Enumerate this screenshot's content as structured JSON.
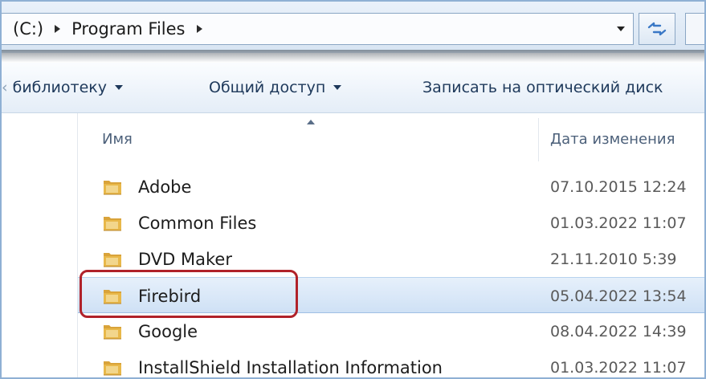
{
  "address_bar": {
    "crumbs": [
      "(C:)",
      "Program Files"
    ]
  },
  "toolbar": {
    "library_label": "библиотеку",
    "share_label": "Общий доступ",
    "burn_label": "Записать на оптический диск"
  },
  "columns": {
    "name": "Имя",
    "date": "Дата изменения"
  },
  "files": [
    {
      "name": "Adobe",
      "date": "07.10.2015 12:24",
      "selected": false
    },
    {
      "name": "Common Files",
      "date": "01.03.2022 11:07",
      "selected": false
    },
    {
      "name": "DVD Maker",
      "date": "21.11.2010 5:39",
      "selected": false
    },
    {
      "name": "Firebird",
      "date": "05.04.2022 13:54",
      "selected": true
    },
    {
      "name": "Google",
      "date": "08.04.2022 14:39",
      "selected": false
    },
    {
      "name": "InstallShield Installation Information",
      "date": "01.03.2022 11:07",
      "selected": false
    }
  ],
  "colors": {
    "highlight_border": "#b0222a",
    "selection": "#cfe1f5",
    "folder": "#e8b84a"
  },
  "icons": {
    "folder": "folder-icon",
    "refresh": "refresh-icon"
  }
}
